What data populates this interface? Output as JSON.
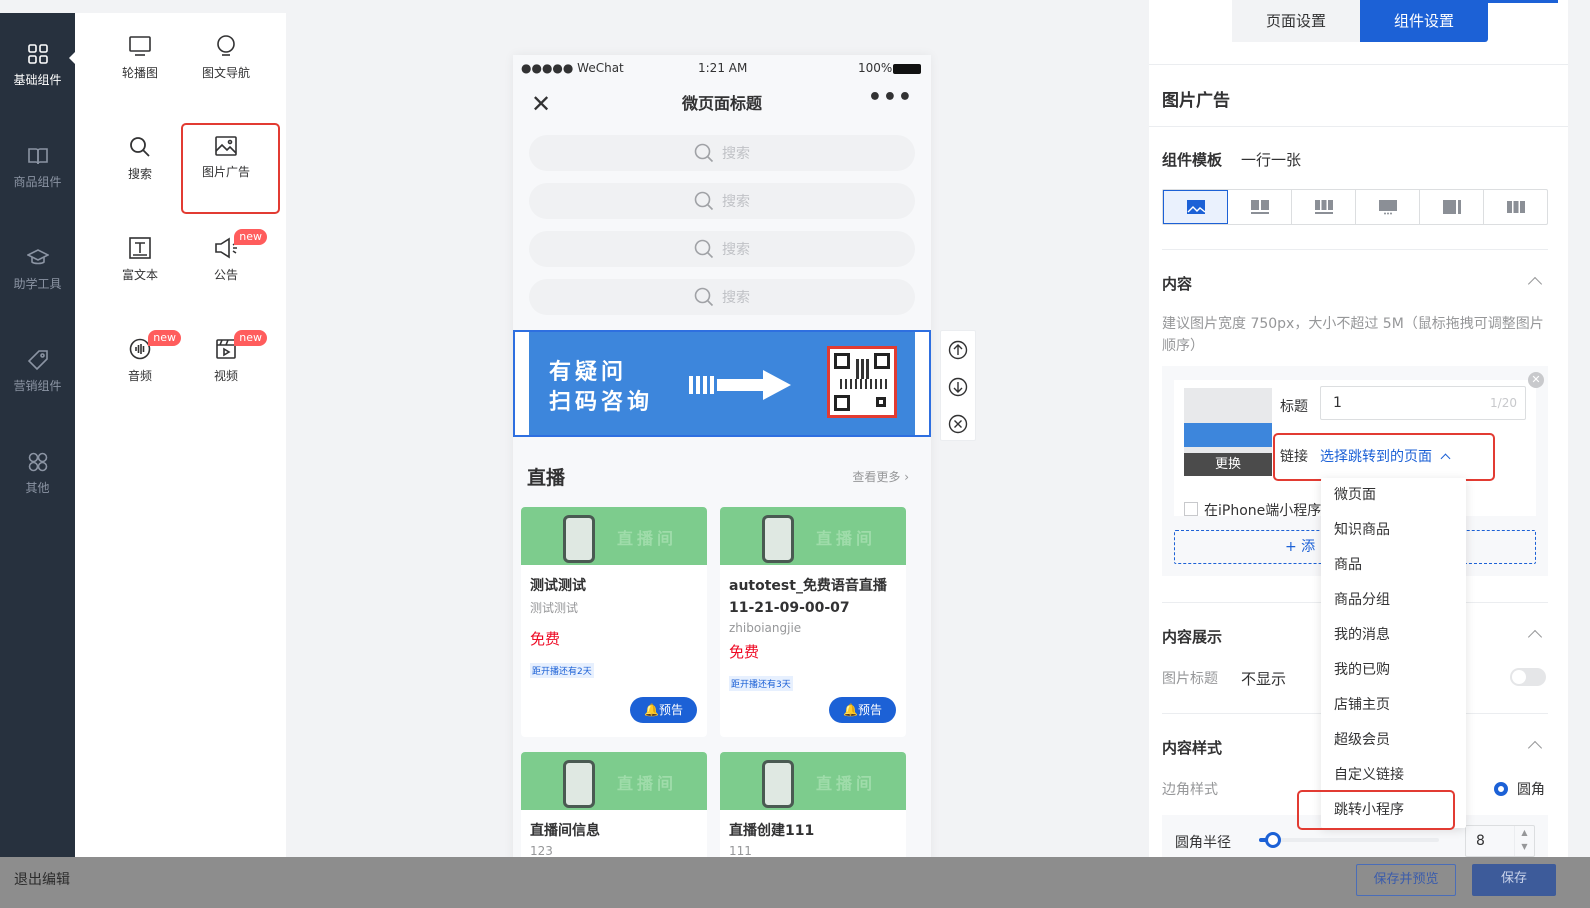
{
  "nav": {
    "items": [
      {
        "label": "基础组件",
        "icon": "grid-icon",
        "active": true
      },
      {
        "label": "商品组件",
        "icon": "book-icon"
      },
      {
        "label": "助学工具",
        "icon": "graduation-cap-icon"
      },
      {
        "label": "营销组件",
        "icon": "tag-icon"
      },
      {
        "label": "其他",
        "icon": "clover-icon"
      }
    ]
  },
  "components": [
    {
      "label": "轮播图",
      "icon": "monitor-icon"
    },
    {
      "label": "图文导航",
      "icon": "bulb-icon"
    },
    {
      "label": "搜索",
      "icon": "search-icon"
    },
    {
      "label": "图片广告",
      "icon": "image-icon"
    },
    {
      "label": "富文本",
      "icon": "richtext-icon"
    },
    {
      "label": "公告",
      "icon": "megaphone-icon",
      "badge": "new"
    },
    {
      "label": "音频",
      "icon": "audio-icon",
      "badge": "new"
    },
    {
      "label": "视频",
      "icon": "video-icon",
      "badge": "new"
    }
  ],
  "phone": {
    "status": {
      "carrier": "●●●●● WeChat",
      "time": "1:21 AM",
      "battery": "100%"
    },
    "page_title": "微页面标题",
    "search_placeholder": "搜索",
    "banner": {
      "line1": "有疑问",
      "line2": "扫码咨询"
    },
    "live": {
      "heading": "直播",
      "more": "查看更多",
      "image_label": "直播间",
      "cards": [
        {
          "title": "测试测试",
          "subtitle": "测试测试",
          "price": "免费",
          "tag": "距开播还有2天",
          "button": "预告"
        },
        {
          "title": "autotest_免费语音直播11-21-09-00-07",
          "subtitle": "zhiboiangjie",
          "price": "免费",
          "tag": "距开播还有3天",
          "button": "预告"
        },
        {
          "title": "直播间信息",
          "subtitle": "123"
        },
        {
          "title": "直播创建111",
          "subtitle": "111"
        }
      ]
    }
  },
  "settings": {
    "tabs": [
      {
        "label": "页面设置"
      },
      {
        "label": "组件设置",
        "active": true
      }
    ],
    "component_title": "图片广告",
    "template_label": "组件模板",
    "template_value": "一行一张",
    "content_label": "内容",
    "hint": "建议图片宽度 750px，大小不超过 5M（鼠标拖拽可调整图片顺序）",
    "item": {
      "replace": "更换",
      "title_label": "标题",
      "title_value": "1",
      "title_counter": "1/20",
      "link_label": "链接",
      "link_value": "选择跳转到的页面",
      "checkbox_label": "在iPhone端小程序",
      "add_label": "+ 添"
    },
    "display_label": "内容展示",
    "image_title_label": "图片标题",
    "image_title_value": "不显示",
    "style_label": "内容样式",
    "corner_label": "边角样式",
    "corner_value": "圆角",
    "radius_label": "圆角半径",
    "radius_value": "8",
    "radius_level": 0.08
  },
  "dropdown": {
    "items": [
      "微页面",
      "知识商品",
      "商品",
      "商品分组",
      "我的消息",
      "我的已购",
      "店铺主页",
      "超级会员",
      "自定义链接",
      "跳转小程序"
    ]
  },
  "bottom": {
    "exit": "退出编辑",
    "save_preview": "保存并预览",
    "save": "保存"
  },
  "colors": {
    "accent": "#1c61d6",
    "highlight": "#e23b32",
    "price": "#ee0a24",
    "nav_bg": "#27313e"
  }
}
